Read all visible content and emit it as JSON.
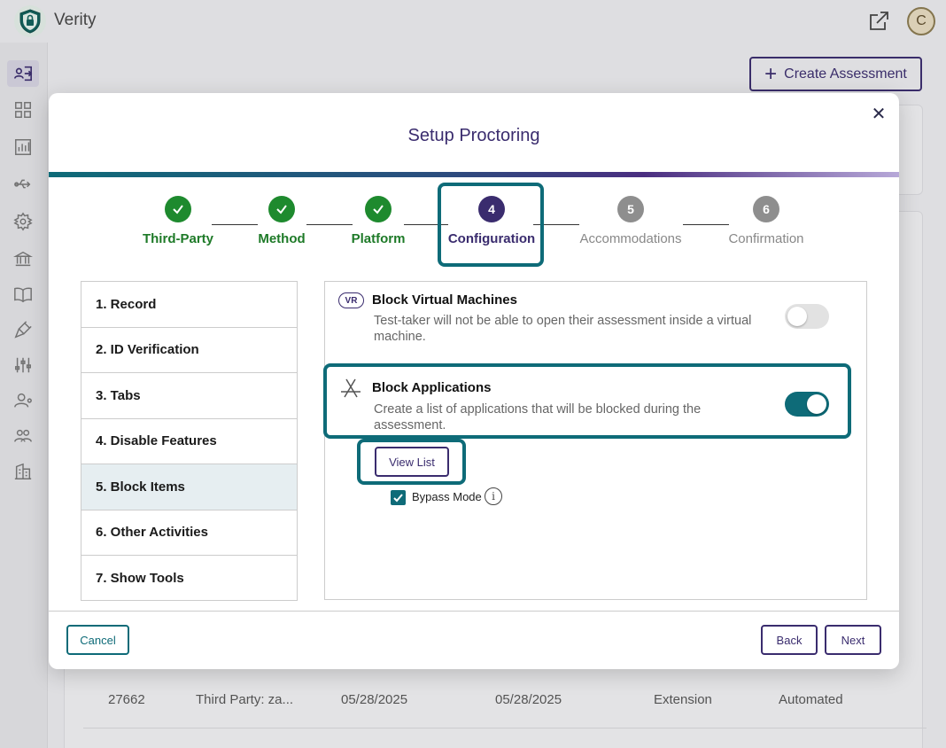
{
  "app": {
    "title": "Verity",
    "avatar_initial": "C"
  },
  "header": {
    "create_assessment_label": "Create Assessment"
  },
  "background_table": {
    "row": [
      "27662",
      "Third Party: za...",
      "05/28/2025",
      "05/28/2025",
      "Extension",
      "Automated"
    ]
  },
  "modal": {
    "title": "Setup Proctoring",
    "steps": [
      {
        "label": "Third-Party",
        "state": "done"
      },
      {
        "label": "Method",
        "state": "done"
      },
      {
        "label": "Platform",
        "state": "done"
      },
      {
        "label": "Configuration",
        "number": "4",
        "state": "current"
      },
      {
        "label": "Accommodations",
        "number": "5",
        "state": "todo"
      },
      {
        "label": "Confirmation",
        "number": "6",
        "state": "todo"
      }
    ],
    "nav_items": [
      "1. Record",
      "2. ID Verification",
      "3. Tabs",
      "4. Disable Features",
      "5. Block Items",
      "6. Other Activities",
      "7. Show Tools"
    ],
    "selected_nav_index": 4,
    "features": {
      "vm": {
        "icon_text": "VR",
        "title": "Block Virtual Machines",
        "description": "Test-taker will not be able to open their assessment inside a virtual machine.",
        "enabled": false
      },
      "apps": {
        "title": "Block Applications",
        "description": "Create a list of applications that will be blocked during the assessment.",
        "enabled": true
      }
    },
    "view_list_label": "View List",
    "bypass_mode_label": "Bypass Mode",
    "bypass_mode_checked": true,
    "footer": {
      "cancel_label": "Cancel",
      "back_label": "Back",
      "next_label": "Next"
    }
  },
  "colors": {
    "teal": "#0e6b78",
    "purple": "#3a2c6e",
    "green": "#1e8a2e"
  }
}
